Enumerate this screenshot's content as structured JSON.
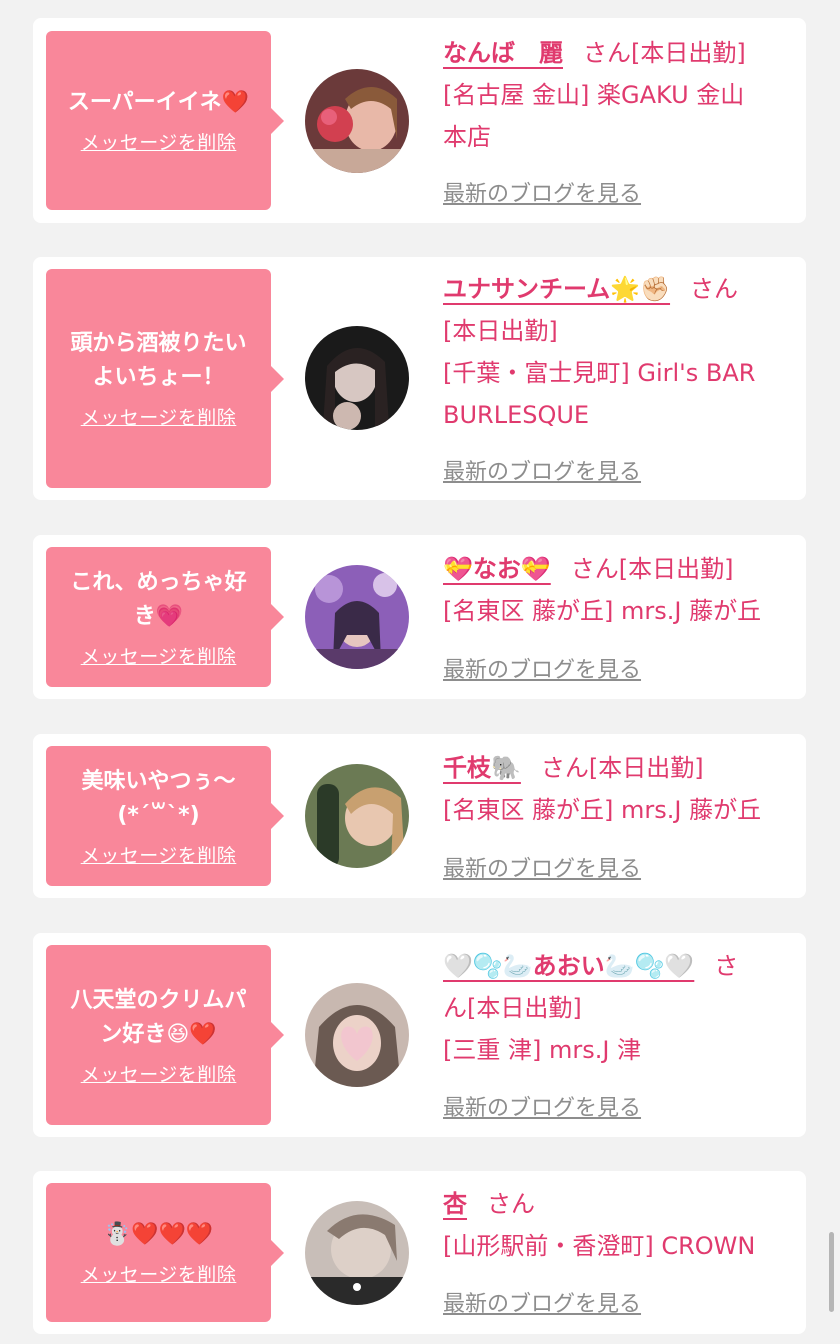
{
  "delete_label": "メッセージを削除",
  "blog_label": "最新のブログを見る",
  "san": "さん",
  "cards": [
    {
      "message_lines": [
        "スーパーイイネ❤️"
      ],
      "name": "なんば　麗",
      "status": "[本日出勤]",
      "area_lines": [
        "[名古屋 金山] 楽GAKU 金山",
        "本店"
      ],
      "avatar_colors": [
        "#6b3a3a",
        "#e8b8a8",
        "#d24050"
      ]
    },
    {
      "message_lines": [
        "頭から酒被りたい",
        "よいちょー！"
      ],
      "name": "ユナサンチーム🌟✊🏻",
      "status": "[本日出勤]",
      "area_lines": [
        "[千葉・富士見町] Girl's BAR",
        "BURLESQUE"
      ],
      "avatar_colors": [
        "#1a1a1a",
        "#d7c7c2",
        "#444444"
      ]
    },
    {
      "message_lines": [
        "これ、めっちゃ好",
        "き💗"
      ],
      "name": "💝なお💝",
      "status": "[本日出勤]",
      "area_lines": [
        "[名東区 藤が丘] mrs.J 藤が丘"
      ],
      "avatar_colors": [
        "#8c5fb8",
        "#d8c2e8",
        "#3a2a48"
      ]
    },
    {
      "message_lines": [
        "美味いやつぅ〜",
        "(*´꒳`*)"
      ],
      "name": "千枝🐘",
      "status": "[本日出勤]",
      "area_lines": [
        "[名東区 藤が丘] mrs.J 藤が丘"
      ],
      "avatar_colors": [
        "#2b3a28",
        "#e8c7b0",
        "#6b7a54"
      ]
    },
    {
      "message_lines": [
        "八天堂のクリムパ",
        "ン好き😆❤️"
      ],
      "name": "🤍🫧🦢あおい🦢🫧🤍",
      "status": "ん[本日出勤]",
      "area_lines": [
        "[三重 津] mrs.J 津"
      ],
      "avatar_colors": [
        "#c8b8b0",
        "#f2c6cf",
        "#6b5a52"
      ]
    },
    {
      "message_lines": [
        "☃️❤️❤️❤️"
      ],
      "name": "杏",
      "status": "",
      "area_lines": [
        "[山形駅前・香澄町] CROWN"
      ],
      "avatar_colors": [
        "#c8beb8",
        "#ddd0c8",
        "#2a2a2a"
      ]
    }
  ]
}
